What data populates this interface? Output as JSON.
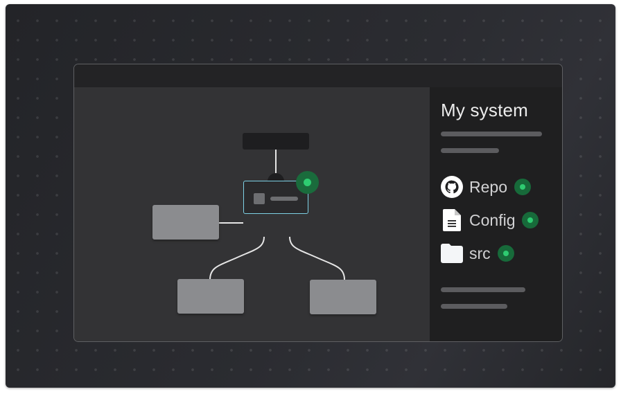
{
  "sidebar": {
    "title": "My system",
    "items": [
      {
        "label": "Repo",
        "icon": "github-icon",
        "status": "active"
      },
      {
        "label": "Config",
        "icon": "document-icon",
        "status": "active"
      },
      {
        "label": "src",
        "icon": "folder-icon",
        "status": "active"
      }
    ]
  },
  "colors": {
    "accent_green": "#2ecc71",
    "selection_outline": "#7ed2e6"
  }
}
